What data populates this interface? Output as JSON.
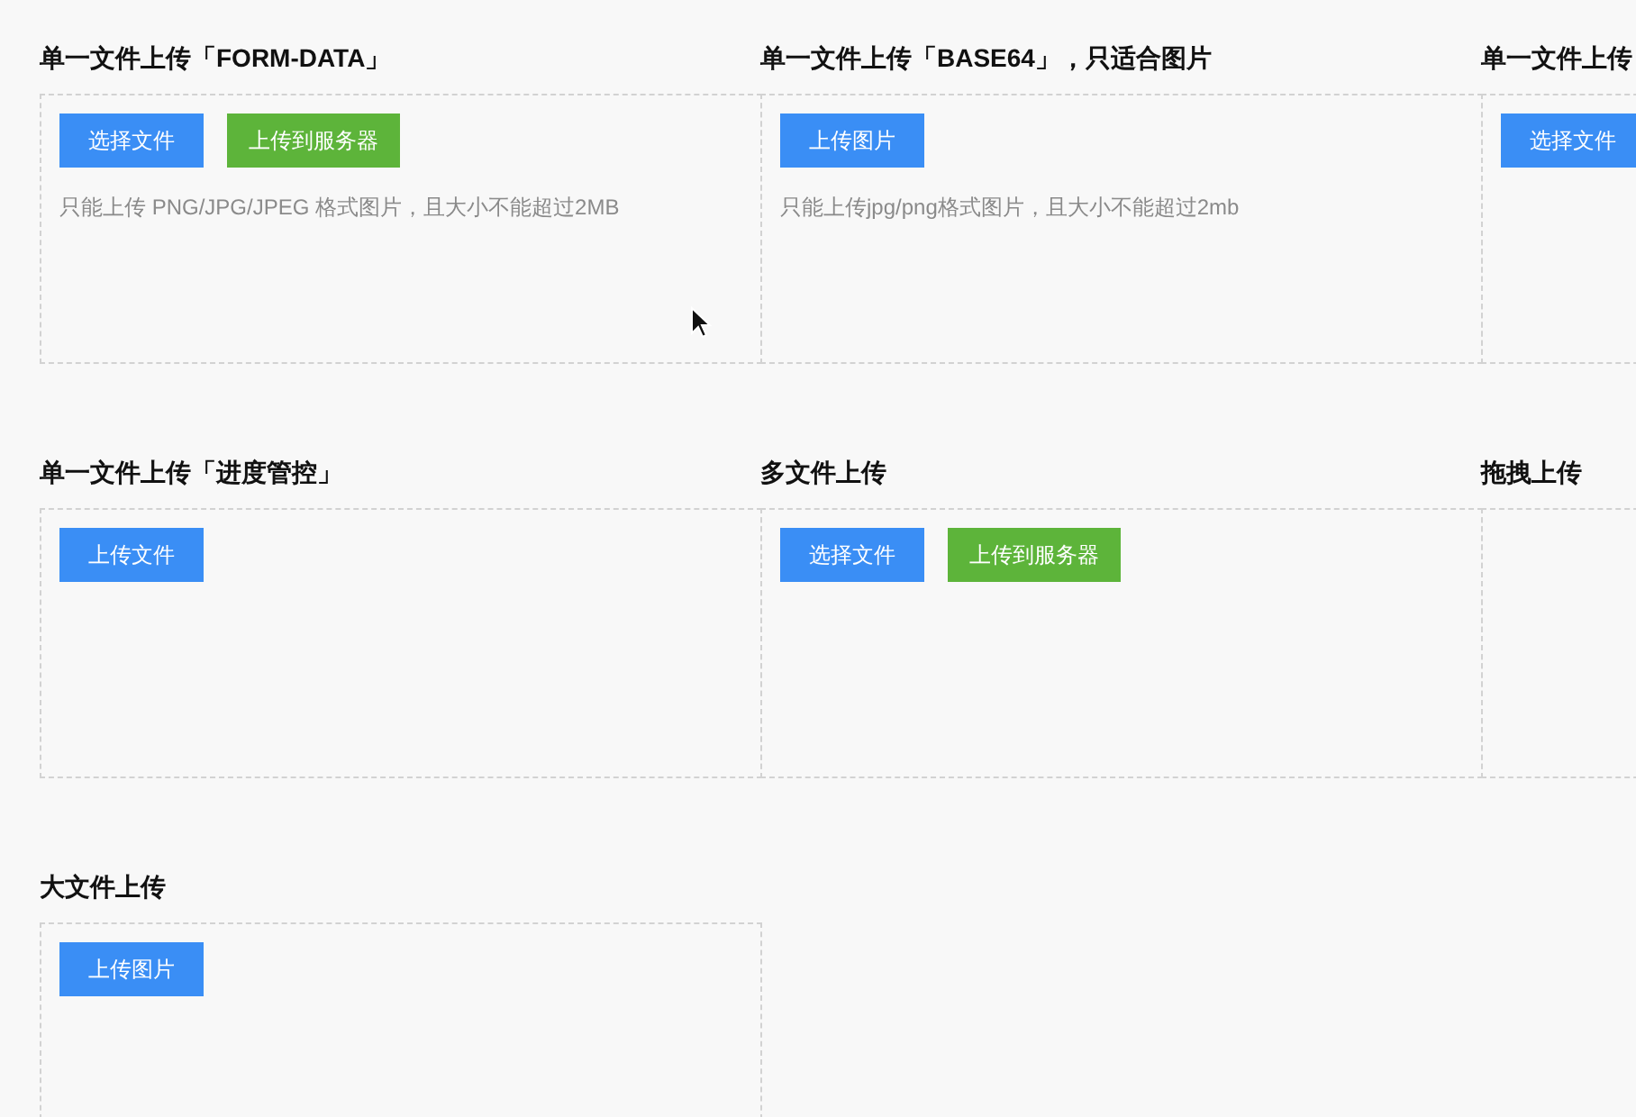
{
  "rows": [
    [
      {
        "title": "单一文件上传「FORM-DATA」",
        "buttons": [
          {
            "label": "选择文件",
            "kind": "primary"
          },
          {
            "label": "上传到服务器",
            "kind": "success"
          }
        ],
        "hint": "只能上传 PNG/JPG/JPEG 格式图片，且大小不能超过2MB"
      },
      {
        "title": "单一文件上传「BASE64」，只适合图片",
        "buttons": [
          {
            "label": "上传图片",
            "kind": "primary"
          }
        ],
        "hint": "只能上传jpg/png格式图片，且大小不能超过2mb"
      },
      {
        "title": "单一文件上传",
        "buttons": [
          {
            "label": "选择文件",
            "kind": "primary"
          }
        ]
      }
    ],
    [
      {
        "title": "单一文件上传「进度管控」",
        "buttons": [
          {
            "label": "上传文件",
            "kind": "primary"
          }
        ]
      },
      {
        "title": "多文件上传",
        "buttons": [
          {
            "label": "选择文件",
            "kind": "primary"
          },
          {
            "label": "上传到服务器",
            "kind": "success"
          }
        ]
      },
      {
        "title": "拖拽上传"
      }
    ],
    [
      {
        "title": "大文件上传",
        "buttons": [
          {
            "label": "上传图片",
            "kind": "primary"
          }
        ]
      }
    ]
  ]
}
